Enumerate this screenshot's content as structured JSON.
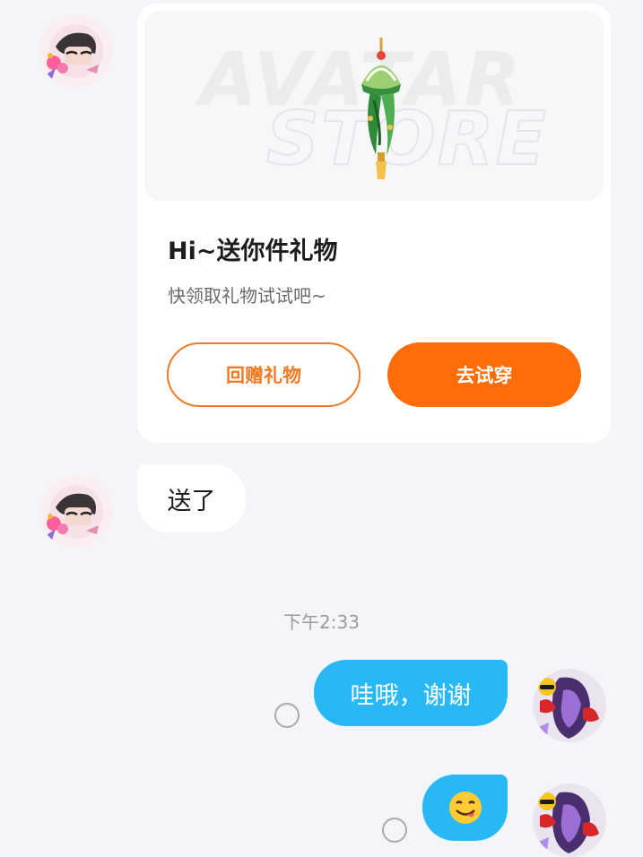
{
  "gift_card": {
    "banner_line1": "AVATAR",
    "banner_line2": "STORE",
    "title": "Hi~送你件礼物",
    "subtitle": "快领取礼物试试吧~",
    "return_gift_label": "回赠礼物",
    "try_on_label": "去试穿",
    "accent_color": "#ff6d09"
  },
  "messages": {
    "incoming_text": "送了",
    "timestamp": "下午2:33",
    "outgoing_text": "哇哦，谢谢",
    "outgoing_emoji": "yum-face-emoji"
  },
  "colors": {
    "outgoing_bubble": "#29b8f6",
    "incoming_bubble": "#ffffff",
    "background": "#f4f5f9"
  },
  "icons": [
    "contact-avatar",
    "my-avatar",
    "send-status-circle",
    "gift-pendant-icon"
  ]
}
